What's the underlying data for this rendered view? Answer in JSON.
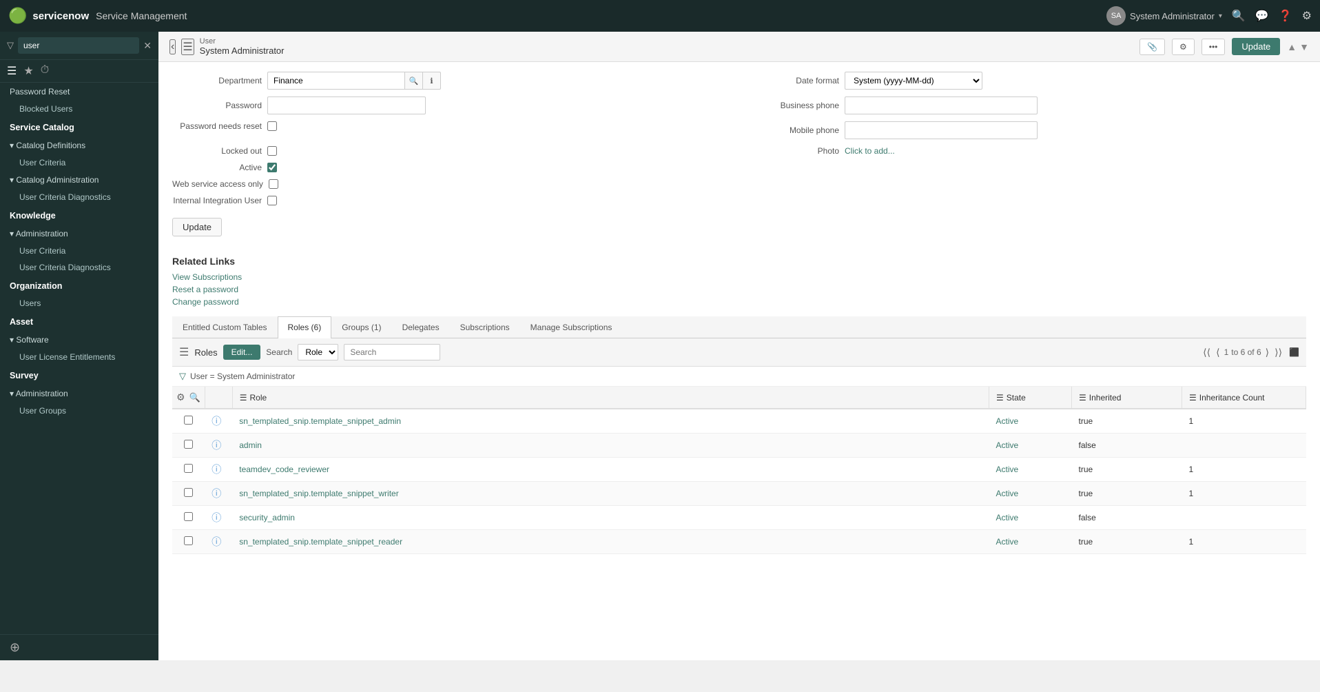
{
  "app": {
    "logo": "serviceNow",
    "title": "Service Management"
  },
  "topnav": {
    "user_name": "System Administrator",
    "search_icon": "🔍",
    "chat_icon": "💬",
    "help_icon": "?",
    "settings_icon": "⚙"
  },
  "sidebar": {
    "search_placeholder": "user",
    "tabs": [
      "filter",
      "favorite",
      "history"
    ],
    "sections": [
      {
        "id": "password-reset",
        "label": "Password Reset",
        "type": "item",
        "depth": 0
      },
      {
        "id": "blocked-users",
        "label": "Blocked Users",
        "type": "subitem"
      },
      {
        "id": "service-catalog",
        "label": "Service Catalog",
        "type": "header"
      },
      {
        "id": "catalog-definitions",
        "label": "▾ Catalog Definitions",
        "type": "group"
      },
      {
        "id": "user-criteria-1",
        "label": "User Criteria",
        "type": "subitem"
      },
      {
        "id": "catalog-administration",
        "label": "▾ Catalog Administration",
        "type": "group"
      },
      {
        "id": "user-criteria-diagnostics-1",
        "label": "User Criteria Diagnostics",
        "type": "subitem"
      },
      {
        "id": "knowledge",
        "label": "Knowledge",
        "type": "header"
      },
      {
        "id": "administration-1",
        "label": "▾ Administration",
        "type": "group"
      },
      {
        "id": "user-criteria-2",
        "label": "User Criteria",
        "type": "subitem"
      },
      {
        "id": "user-criteria-diagnostics-2",
        "label": "User Criteria Diagnostics",
        "type": "subitem"
      },
      {
        "id": "organization",
        "label": "Organization",
        "type": "header"
      },
      {
        "id": "users",
        "label": "Users",
        "type": "subitem"
      },
      {
        "id": "asset",
        "label": "Asset",
        "type": "header"
      },
      {
        "id": "software",
        "label": "▾ Software",
        "type": "group"
      },
      {
        "id": "user-license-entitlements",
        "label": "User License Entitlements",
        "type": "subitem"
      },
      {
        "id": "survey",
        "label": "Survey",
        "type": "header"
      },
      {
        "id": "administration-2",
        "label": "▾ Administration",
        "type": "group"
      },
      {
        "id": "user-groups",
        "label": "User Groups",
        "type": "subitem"
      }
    ]
  },
  "content_header": {
    "record_type": "User",
    "record_name": "System Administrator",
    "update_button": "Update",
    "back_arrow": "‹",
    "menu_icon": "☰",
    "attachment_icon": "📎",
    "settings_icon": "⚙",
    "more_icon": "•••",
    "up_arrow": "▲",
    "down_arrow": "▼"
  },
  "form_fields": {
    "department_label": "Department",
    "department_value": "Finance",
    "date_format_label": "Date format",
    "date_format_value": "System (yyyy-MM-dd)",
    "password_label": "Password",
    "password_value": "",
    "business_phone_label": "Business phone",
    "business_phone_value": "",
    "password_reset_label": "Password needs reset",
    "password_reset_checked": false,
    "mobile_phone_label": "Mobile phone",
    "mobile_phone_value": "",
    "locked_out_label": "Locked out",
    "locked_out_checked": false,
    "photo_label": "Photo",
    "photo_link": "Click to add...",
    "active_label": "Active",
    "active_checked": true,
    "web_service_label": "Web service access only",
    "web_service_checked": false,
    "internal_integration_label": "Internal Integration User",
    "internal_integration_checked": false,
    "update_button": "Update"
  },
  "related_links": {
    "title": "Related Links",
    "links": [
      "View Subscriptions",
      "Reset a password",
      "Change password"
    ]
  },
  "tabs": {
    "items": [
      {
        "id": "entitled-custom-tables",
        "label": "Entitled Custom Tables"
      },
      {
        "id": "roles",
        "label": "Roles (6)"
      },
      {
        "id": "groups",
        "label": "Groups (1)"
      },
      {
        "id": "delegates",
        "label": "Delegates"
      },
      {
        "id": "subscriptions",
        "label": "Subscriptions"
      },
      {
        "id": "manage-subscriptions",
        "label": "Manage Subscriptions"
      }
    ],
    "active": "roles"
  },
  "table_toolbar": {
    "menu_icon": "☰",
    "label": "Roles",
    "edit_button": "Edit...",
    "search_label": "Search",
    "search_field_options": [
      "Role"
    ],
    "search_placeholder": "Search",
    "pagination": {
      "first": "⟨⟨",
      "prev": "⟨",
      "current_page": "1",
      "total_pages": "to 6 of 6",
      "next": "⟩",
      "last": "⟩⟩"
    },
    "collapse_icon": "⬜"
  },
  "filter_info": {
    "icon": "▽",
    "text": "User = System Administrator"
  },
  "table": {
    "columns": [
      {
        "id": "checkbox",
        "label": ""
      },
      {
        "id": "info",
        "label": ""
      },
      {
        "id": "role",
        "label": "Role"
      },
      {
        "id": "state",
        "label": "State"
      },
      {
        "id": "inherited",
        "label": "Inherited"
      },
      {
        "id": "count",
        "label": "Inheritance Count"
      }
    ],
    "rows": [
      {
        "id": 1,
        "role": "sn_templated_snip.template_snippet_admin",
        "state": "Active",
        "inherited": "true",
        "count": "1"
      },
      {
        "id": 2,
        "role": "admin",
        "state": "Active",
        "inherited": "false",
        "count": ""
      },
      {
        "id": 3,
        "role": "teamdev_code_reviewer",
        "state": "Active",
        "inherited": "true",
        "count": "1"
      },
      {
        "id": 4,
        "role": "sn_templated_snip.template_snippet_writer",
        "state": "Active",
        "inherited": "true",
        "count": "1"
      },
      {
        "id": 5,
        "role": "security_admin",
        "state": "Active",
        "inherited": "false",
        "count": ""
      },
      {
        "id": 6,
        "role": "sn_templated_snip.template_snippet_reader",
        "state": "Active",
        "inherited": "true",
        "count": "1"
      }
    ]
  }
}
